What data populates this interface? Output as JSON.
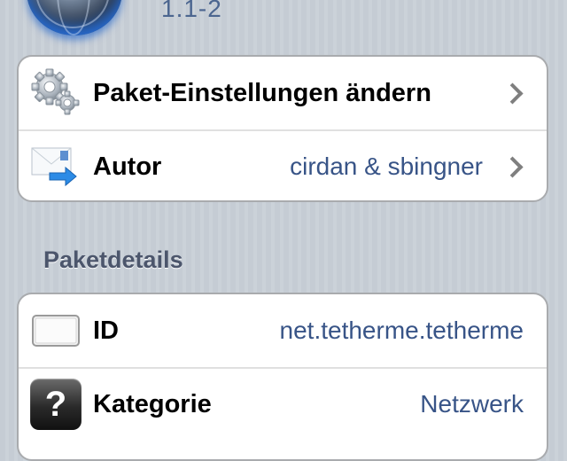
{
  "header": {
    "icon": "globe-app-icon",
    "version": "1.1-2"
  },
  "actions": [
    {
      "label": "Paket-Einstellungen ändern",
      "icon": "gears-icon",
      "value": ""
    },
    {
      "label": "Autor",
      "icon": "mail-forward-icon",
      "value": "cirdan & sbingner"
    }
  ],
  "section": {
    "title": "Paketdetails"
  },
  "details": [
    {
      "label": "ID",
      "icon": "id-card-icon",
      "value": "net.tetherme.tetherme"
    },
    {
      "label": "Kategorie",
      "icon": "question-icon",
      "value": "Netzwerk"
    }
  ],
  "colors": {
    "background": "#c5ccd4",
    "value_text": "#385487",
    "section_text": "#4c566c",
    "chevron": "#7f7f7f"
  }
}
